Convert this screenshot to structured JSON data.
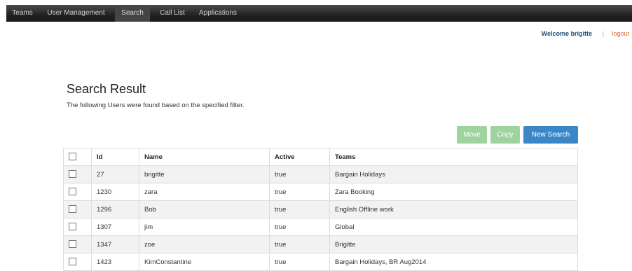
{
  "nav": {
    "items": [
      {
        "label": "Teams"
      },
      {
        "label": "User Management"
      },
      {
        "label": "Search"
      },
      {
        "label": "Call List"
      },
      {
        "label": "Applications"
      }
    ]
  },
  "userbar": {
    "welcome": "Welcome brigitte",
    "separator": "|",
    "logout": "logout"
  },
  "page": {
    "title": "Search Result",
    "subtitle": "The following Users were found based on the specified filter."
  },
  "actions": {
    "move": "Move",
    "copy": "Copy",
    "new_search": "New Search"
  },
  "table": {
    "headers": {
      "id": "Id",
      "name": "Name",
      "active": "Active",
      "teams": "Teams"
    },
    "rows": [
      {
        "id": "27",
        "name": "brigitte",
        "active": "true",
        "teams": "Bargain Holidays"
      },
      {
        "id": "1230",
        "name": "zara",
        "active": "true",
        "teams": "Zara Booking"
      },
      {
        "id": "1296",
        "name": "Bob",
        "active": "true",
        "teams": "English Offline work"
      },
      {
        "id": "1307",
        "name": "jim",
        "active": "true",
        "teams": "Global"
      },
      {
        "id": "1347",
        "name": "zoe",
        "active": "true",
        "teams": "Brigitte"
      },
      {
        "id": "1423",
        "name": "KimConstantine",
        "active": "true",
        "teams": "Bargain Holidays, BR Aug2014"
      }
    ]
  },
  "colors": {
    "nav_bg": "#222222",
    "accent_blue": "#3a87c8",
    "accent_green": "#9ed29e",
    "logout": "#d9662b"
  }
}
